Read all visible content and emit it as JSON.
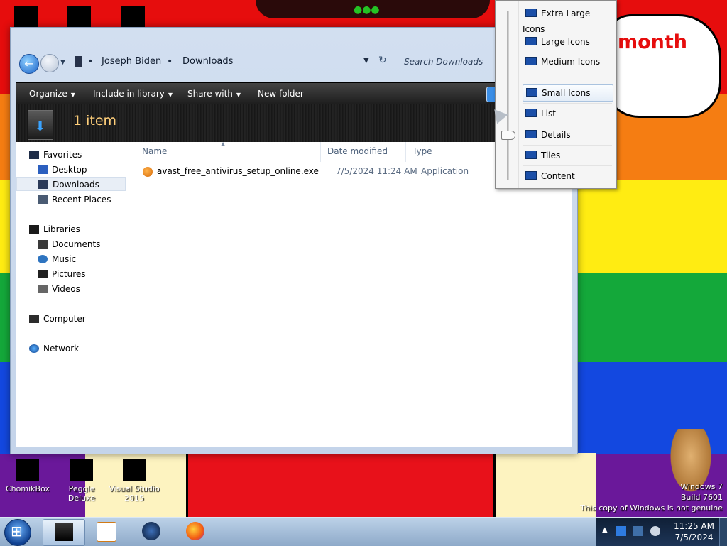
{
  "desktop": {
    "bubble_text": "month",
    "icons": [
      {
        "label": "ChomikBox"
      },
      {
        "label": "Peggle Deluxe"
      },
      {
        "label": "Visual Studio 2015"
      }
    ],
    "watermark_line1": "Windows 7",
    "watermark_line2": "Build 7601",
    "watermark_line3": "This copy of Windows is not genuine"
  },
  "explorer": {
    "breadcrumb": [
      "Joseph Biden",
      "Downloads"
    ],
    "search_placeholder": "Search Downloads",
    "toolbar": {
      "organize": "Organize",
      "include_in_library": "Include in library",
      "share_with": "Share with",
      "new_folder": "New folder"
    },
    "item_count": "1 item",
    "nav": {
      "favorites": "Favorites",
      "desktop": "Desktop",
      "downloads": "Downloads",
      "recent_places": "Recent Places",
      "libraries": "Libraries",
      "documents": "Documents",
      "music": "Music",
      "pictures": "Pictures",
      "videos": "Videos",
      "computer": "Computer",
      "network": "Network"
    },
    "columns": {
      "name": "Name",
      "date_modified": "Date modified",
      "type": "Type"
    },
    "files": [
      {
        "name": "avast_free_antivirus_setup_online.exe",
        "date": "7/5/2024 11:24 AM",
        "type": "Application"
      }
    ]
  },
  "view_menu": {
    "items": [
      "Extra Large Icons",
      "Large Icons",
      "Medium Icons",
      "Small Icons",
      "List",
      "Details",
      "Tiles",
      "Content"
    ],
    "highlighted": "Small Icons"
  },
  "taskbar": {
    "time": "11:25 AM",
    "date": "7/5/2024"
  },
  "colors": {
    "rainbow_red": "#e60d0d",
    "rainbow_orange": "#f57d12",
    "rainbow_yellow": "#ffec12",
    "rainbow_green": "#14a83a",
    "rainbow_blue": "#1348e0",
    "rainbow_purple": "#6a189a",
    "item_count_text": "#ffcf7a"
  }
}
